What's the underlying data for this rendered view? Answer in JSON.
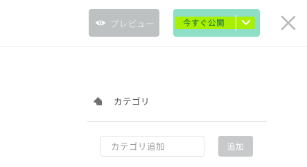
{
  "header": {
    "preview_label": "プレビュー",
    "preview_icon": "eye-icon",
    "publish_label": "今すぐ公開",
    "publish_menu_icon": "chevron-down-icon",
    "close_icon": "close-icon"
  },
  "category": {
    "icon": "tag-icon",
    "title": "カテゴリ",
    "input_placeholder": "カテゴリ追加",
    "input_value": "",
    "add_label": "追加"
  },
  "colors": {
    "preview_bg": "#bdc1c2",
    "publish_bg": "#8fdfc6",
    "publish_highlight": "#a8f000",
    "add_bg": "#c7c9ca"
  }
}
